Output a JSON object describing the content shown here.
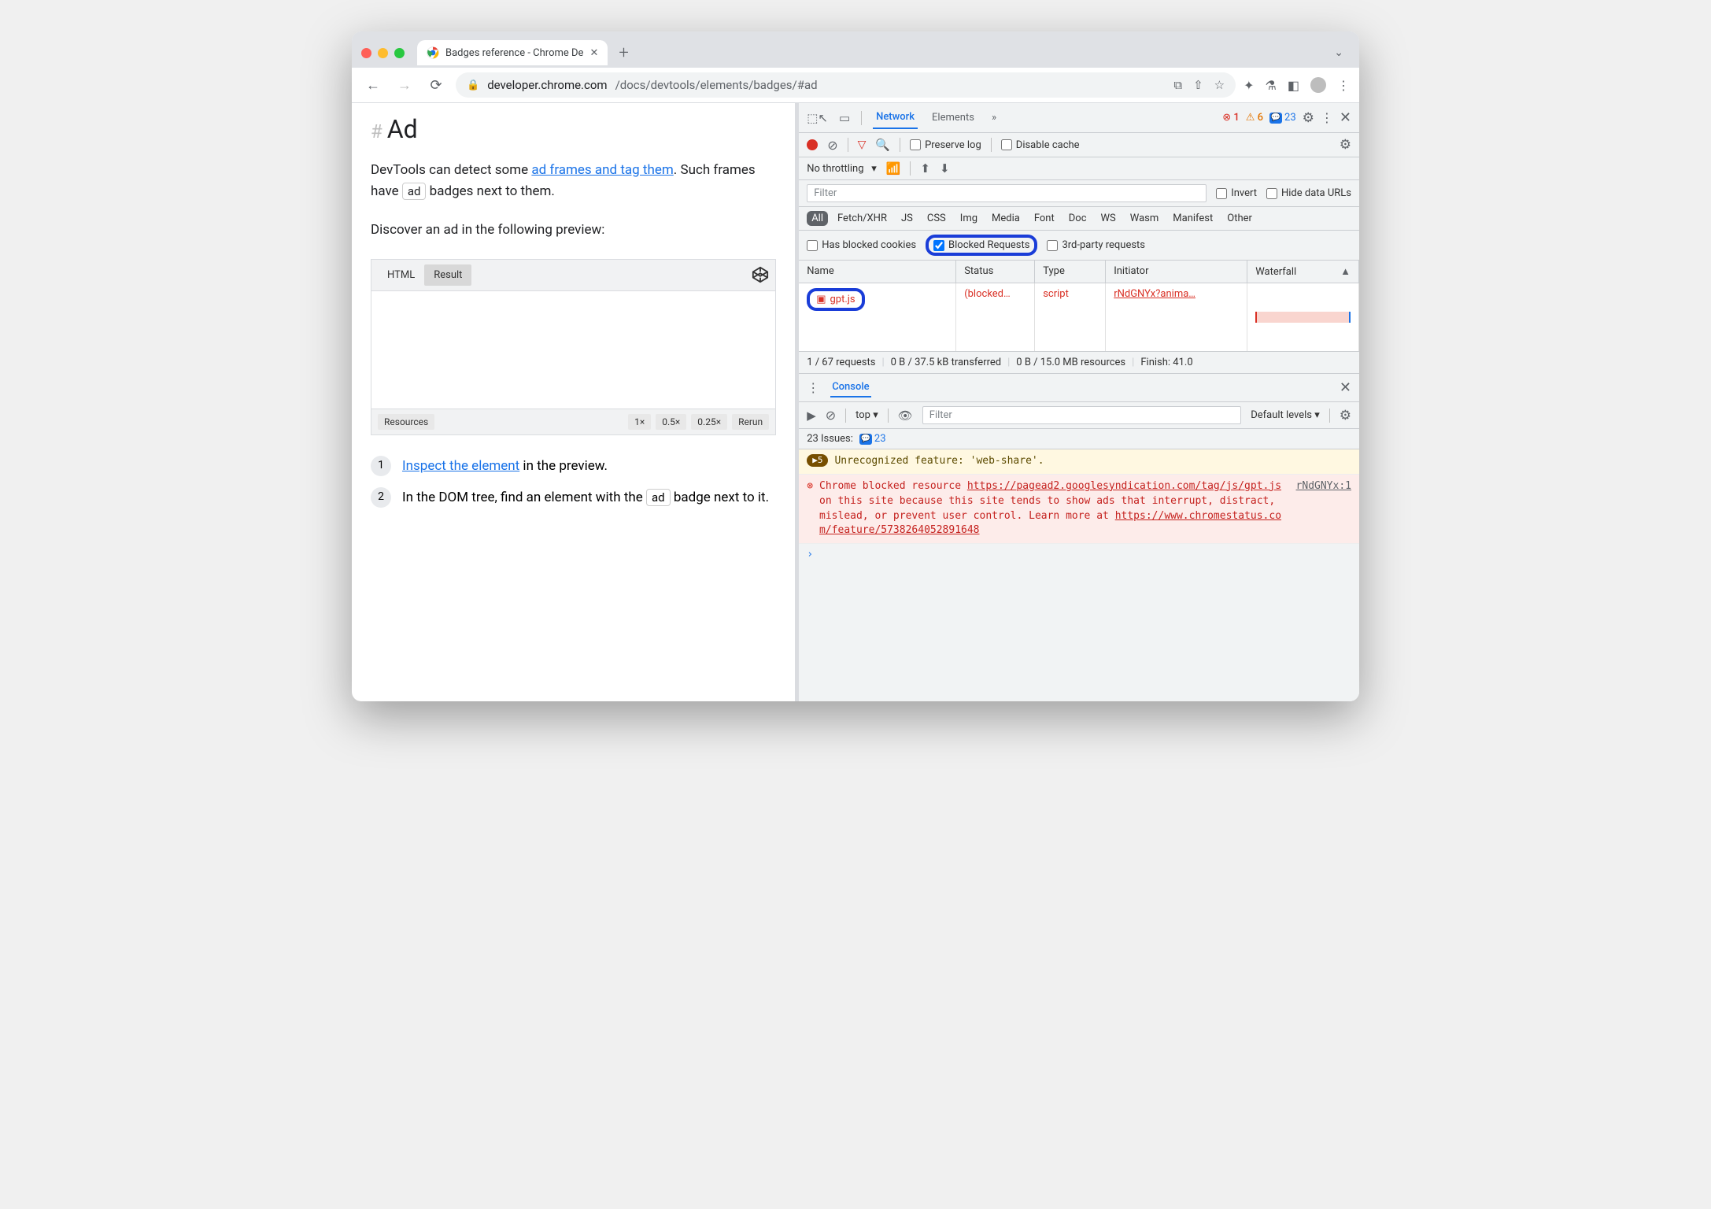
{
  "browser": {
    "tab_title": "Badges reference - Chrome De",
    "url_host": "developer.chrome.com",
    "url_path": "/docs/devtools/elements/badges/#ad"
  },
  "page": {
    "heading": "Ad",
    "para1_pre": "DevTools can detect some ",
    "para1_link": "ad frames and tag them",
    "para1_post1": ". Such frames have ",
    "para1_badge": "ad",
    "para1_post2": " badges next to them.",
    "para2": "Discover an ad in the following preview:",
    "codepen": {
      "tab_html": "HTML",
      "tab_result": "Result",
      "resources": "Resources",
      "z1": "1×",
      "z05": "0.5×",
      "z025": "0.25×",
      "rerun": "Rerun"
    },
    "step1_link": "Inspect the element",
    "step1_post": " in the preview.",
    "step2_pre": "In the DOM tree, find an element with the ",
    "step2_badge": "ad",
    "step2_post": " badge next to it.",
    "step1_num": "1",
    "step2_num": "2"
  },
  "devtools": {
    "tabs": {
      "network": "Network",
      "elements": "Elements",
      "more": "»"
    },
    "badges": {
      "errors": "1",
      "warnings": "6",
      "issues": "23"
    },
    "network": {
      "preserve_log": "Preserve log",
      "disable_cache": "Disable cache",
      "throttling": "No throttling",
      "filter_placeholder": "Filter",
      "invert": "Invert",
      "hide_data_urls": "Hide data URLs",
      "types": [
        "All",
        "Fetch/XHR",
        "JS",
        "CSS",
        "Img",
        "Media",
        "Font",
        "Doc",
        "WS",
        "Wasm",
        "Manifest",
        "Other"
      ],
      "has_blocked_cookies": "Has blocked cookies",
      "blocked_requests": "Blocked Requests",
      "third_party": "3rd-party requests",
      "columns": {
        "name": "Name",
        "status": "Status",
        "type": "Type",
        "initiator": "Initiator",
        "waterfall": "Waterfall"
      },
      "row": {
        "name": "gpt.js",
        "status": "(blocked…",
        "type": "script",
        "initiator": "rNdGNYx?anima…"
      },
      "status": {
        "requests": "1 / 67 requests",
        "transferred": "0 B / 37.5 kB transferred",
        "resources": "0 B / 15.0 MB resources",
        "finish": "Finish: 41.0"
      }
    },
    "console": {
      "title": "Console",
      "context": "top",
      "filter_placeholder": "Filter",
      "levels": "Default levels",
      "issues_label": "23 Issues:",
      "issues_count": "23",
      "warn_count": "5",
      "warn_msg": "Unrecognized feature: 'web-share'.",
      "err_pre": "Chrome blocked resource ",
      "err_url1": "https://pagead2.googlesyndication.com/tag/js/gpt.js",
      "err_mid": " on this site because this site tends to show ads that interrupt, distract, mislead, or prevent user control. Learn more at ",
      "err_url2": "https://www.chromestatus.com/feature/5738264052891648",
      "err_src": "rNdGNYx:1"
    }
  }
}
